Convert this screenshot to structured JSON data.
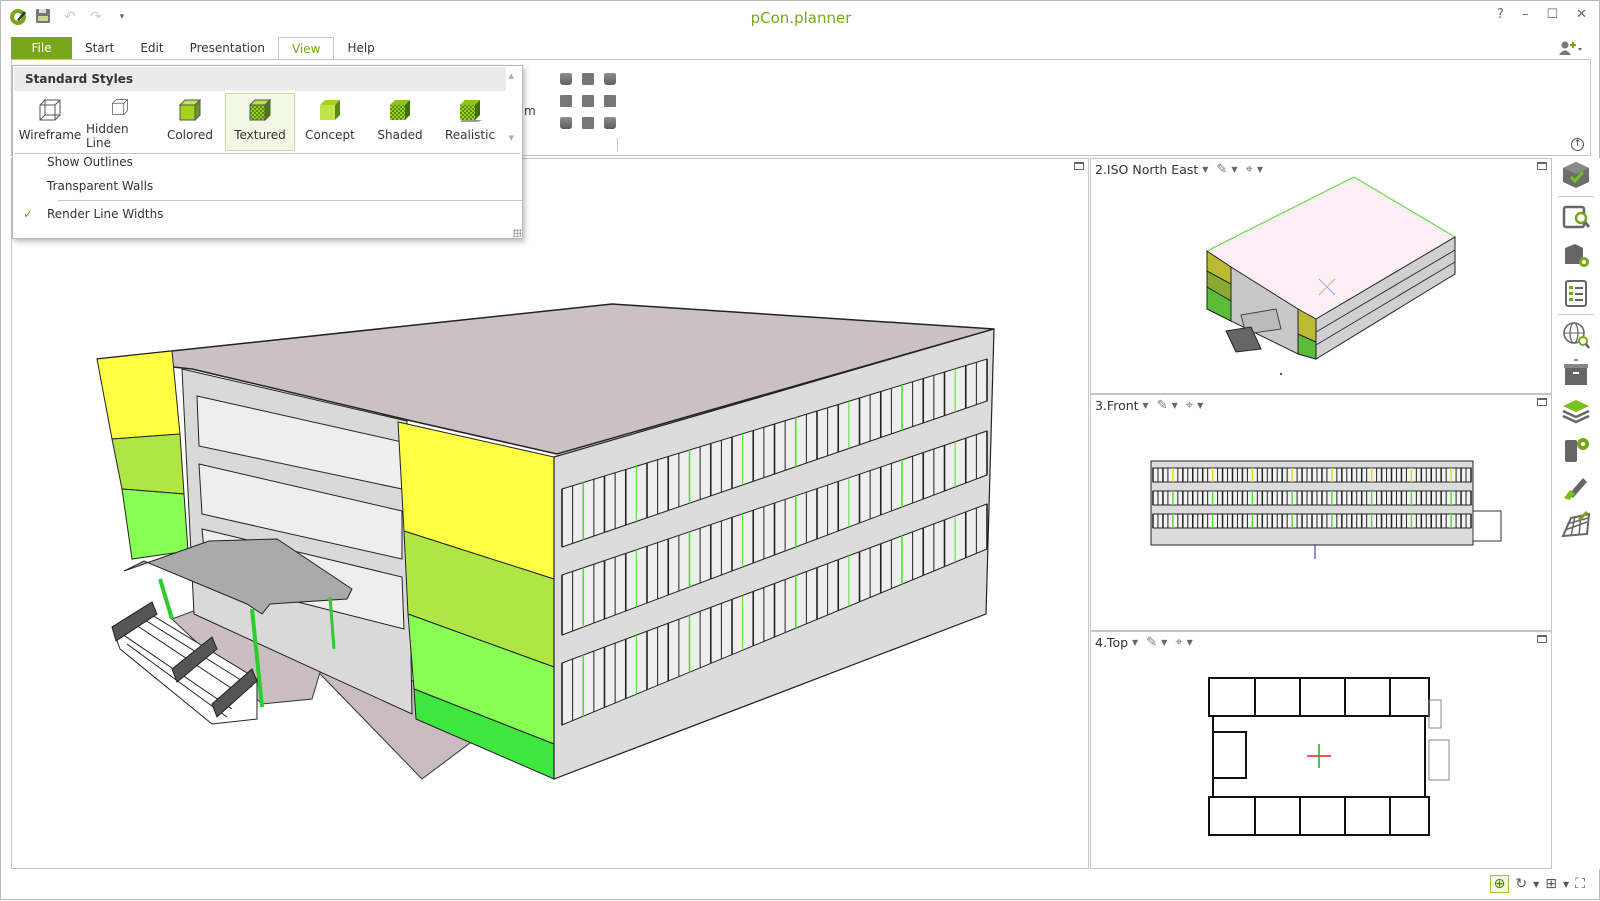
{
  "app": {
    "title": "pCon.planner",
    "accent_color": "#78a51a"
  },
  "quick_access": {
    "logo_icon": "pcon-logo-icon",
    "save_icon": "save-icon",
    "undo_icon": "undo-icon",
    "redo_icon": "redo-icon",
    "customize_icon": "customize-dropdown-icon"
  },
  "window_controls": {
    "help": "?",
    "minimize": "–",
    "maximize": "☐",
    "close": "✕"
  },
  "ribbon": {
    "tabs": [
      {
        "label": "File",
        "active": false
      },
      {
        "label": "Start",
        "active": false
      },
      {
        "label": "Edit",
        "active": false
      },
      {
        "label": "Presentation",
        "active": false
      },
      {
        "label": "View",
        "active": true
      },
      {
        "label": "Help",
        "active": false
      }
    ],
    "partial_label": "m",
    "user_icon": "add-user-icon",
    "collapse_icon": "collapse-ribbon-icon"
  },
  "style_dropdown": {
    "header": "Standard Styles",
    "styles": [
      {
        "label": "Wireframe",
        "selected": false
      },
      {
        "label": "Hidden Line",
        "selected": false
      },
      {
        "label": "Colored",
        "selected": false
      },
      {
        "label": "Textured",
        "selected": true
      },
      {
        "label": "Concept",
        "selected": false
      },
      {
        "label": "Shaded",
        "selected": false
      },
      {
        "label": "Realistic",
        "selected": false
      }
    ],
    "options": [
      {
        "label": "Show Outlines",
        "checked": false
      },
      {
        "label": "Transparent Walls",
        "checked": false
      },
      {
        "label": "Render Line Widths",
        "checked": true
      }
    ]
  },
  "viewports": [
    {
      "title": "2.ISO North East"
    },
    {
      "title": "3.Front"
    },
    {
      "title": "4.Top"
    }
  ],
  "right_toolbar": [
    "catalog-3d-icon",
    "search-catalog-icon",
    "article-settings-icon",
    "article-list-icon",
    "web-search-icon",
    "archive-icon",
    "layers-icon",
    "layer-settings-icon",
    "pen-icon",
    "terrain-icon"
  ],
  "status_bar": {
    "icons": [
      "pan-icon",
      "rotate-icon",
      "layout-icon",
      "fullscreen-icon"
    ]
  }
}
